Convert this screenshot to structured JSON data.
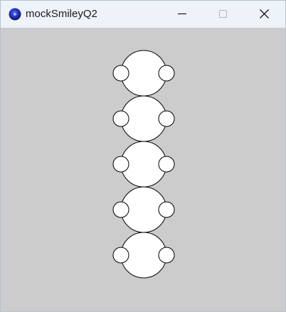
{
  "window": {
    "title": "mockSmileyQ2",
    "app_icon": "processing-app-icon",
    "controls": {
      "minimize": "minimize-icon",
      "maximize": "maximize-icon",
      "close": "close-icon"
    }
  },
  "canvas": {
    "background": "#cccccc",
    "figure_count": 5,
    "fill": "#ffffff",
    "stroke": "#000000"
  }
}
